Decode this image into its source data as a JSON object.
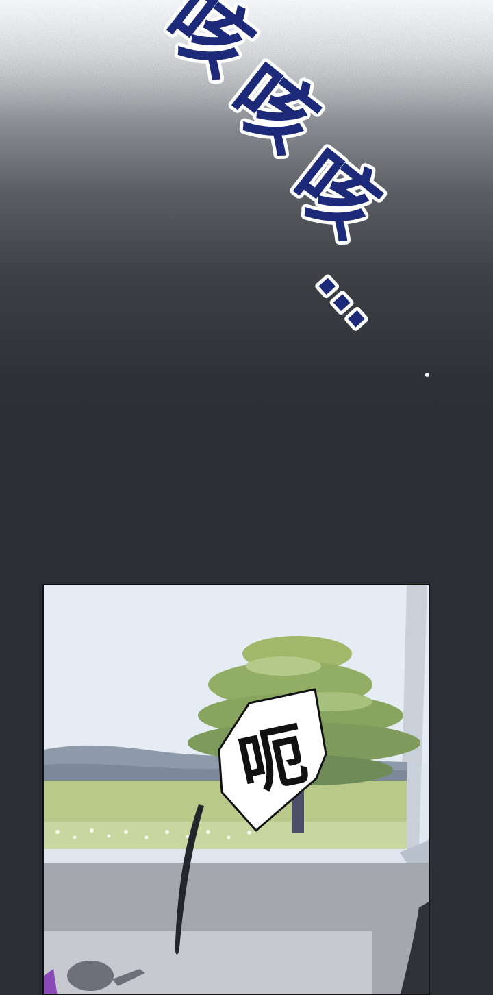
{
  "sfx": {
    "chars": [
      "咳",
      "咳",
      "咳",
      "…"
    ],
    "color": "#1d2a7a"
  },
  "panel": {
    "speech": "呃",
    "scene": "window-view-with-tree"
  },
  "colors": {
    "background": "#2b2f33",
    "sky": "#dfe7f1",
    "grass": "#b9c98a"
  }
}
